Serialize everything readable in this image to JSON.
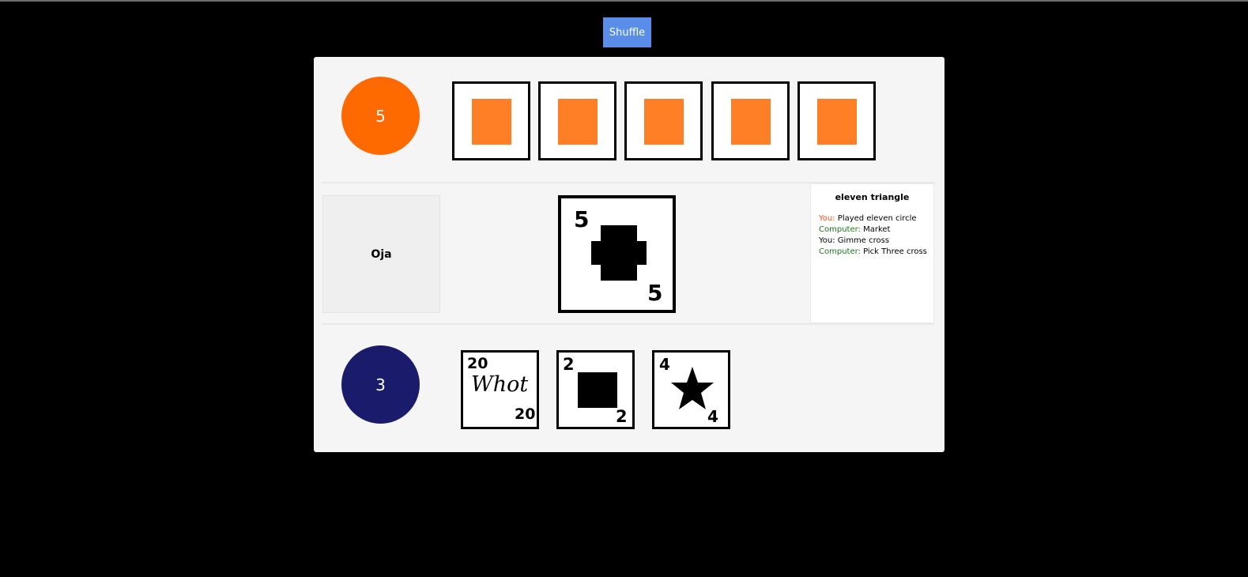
{
  "toolbar": {
    "shuffle_label": "Shuffle"
  },
  "opponent": {
    "card_count": "5",
    "avatar_color": "#ff6a00",
    "card_back_color": "#ff7f27",
    "hidden_cards": 5
  },
  "market": {
    "label": "Oja"
  },
  "played_card": {
    "number": "5",
    "shape": "cross-icon"
  },
  "log": {
    "title": "eleven triangle",
    "entries": [
      {
        "who": "You:",
        "text": " Played eleven circle"
      },
      {
        "who": "Computer:",
        "text": " Market"
      },
      {
        "who": "You:",
        "text": " Gimme cross"
      },
      {
        "who": "Computer:",
        "text": " Pick Three cross"
      }
    ]
  },
  "player": {
    "card_count": "3",
    "avatar_color": "#1b1b6b",
    "hand": [
      {
        "number": "20",
        "shape": "whot-icon",
        "label": "Whot"
      },
      {
        "number": "2",
        "shape": "square-icon"
      },
      {
        "number": "4",
        "shape": "star-icon"
      }
    ]
  }
}
